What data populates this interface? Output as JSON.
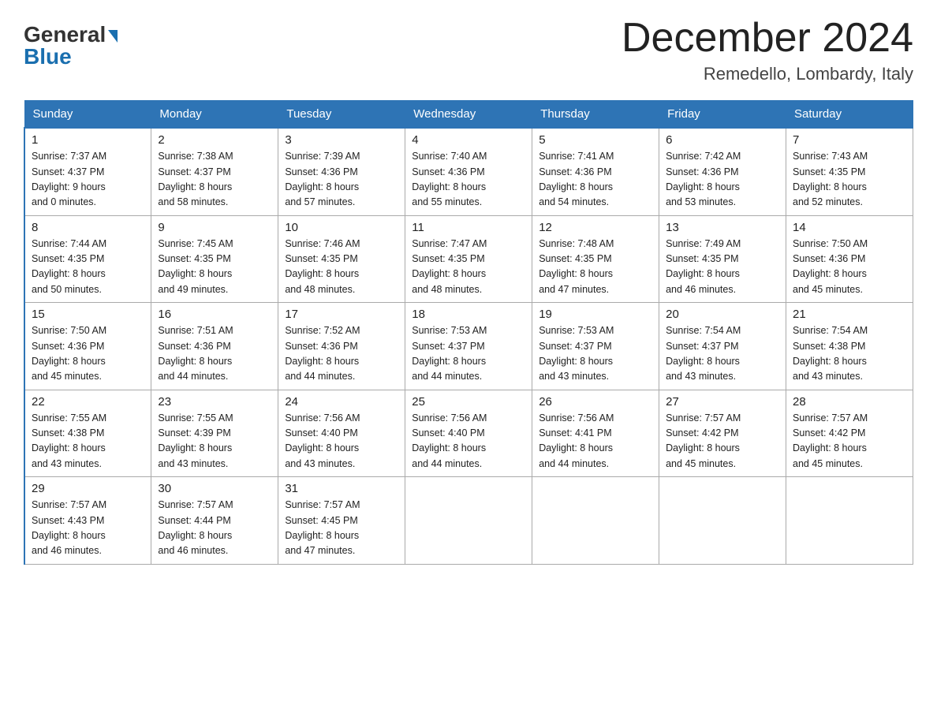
{
  "header": {
    "logo_general": "General",
    "logo_blue": "Blue",
    "month_title": "December 2024",
    "location": "Remedello, Lombardy, Italy"
  },
  "days_of_week": [
    "Sunday",
    "Monday",
    "Tuesday",
    "Wednesday",
    "Thursday",
    "Friday",
    "Saturday"
  ],
  "weeks": [
    [
      {
        "day": "1",
        "info": "Sunrise: 7:37 AM\nSunset: 4:37 PM\nDaylight: 9 hours\nand 0 minutes."
      },
      {
        "day": "2",
        "info": "Sunrise: 7:38 AM\nSunset: 4:37 PM\nDaylight: 8 hours\nand 58 minutes."
      },
      {
        "day": "3",
        "info": "Sunrise: 7:39 AM\nSunset: 4:36 PM\nDaylight: 8 hours\nand 57 minutes."
      },
      {
        "day": "4",
        "info": "Sunrise: 7:40 AM\nSunset: 4:36 PM\nDaylight: 8 hours\nand 55 minutes."
      },
      {
        "day": "5",
        "info": "Sunrise: 7:41 AM\nSunset: 4:36 PM\nDaylight: 8 hours\nand 54 minutes."
      },
      {
        "day": "6",
        "info": "Sunrise: 7:42 AM\nSunset: 4:36 PM\nDaylight: 8 hours\nand 53 minutes."
      },
      {
        "day": "7",
        "info": "Sunrise: 7:43 AM\nSunset: 4:35 PM\nDaylight: 8 hours\nand 52 minutes."
      }
    ],
    [
      {
        "day": "8",
        "info": "Sunrise: 7:44 AM\nSunset: 4:35 PM\nDaylight: 8 hours\nand 50 minutes."
      },
      {
        "day": "9",
        "info": "Sunrise: 7:45 AM\nSunset: 4:35 PM\nDaylight: 8 hours\nand 49 minutes."
      },
      {
        "day": "10",
        "info": "Sunrise: 7:46 AM\nSunset: 4:35 PM\nDaylight: 8 hours\nand 48 minutes."
      },
      {
        "day": "11",
        "info": "Sunrise: 7:47 AM\nSunset: 4:35 PM\nDaylight: 8 hours\nand 48 minutes."
      },
      {
        "day": "12",
        "info": "Sunrise: 7:48 AM\nSunset: 4:35 PM\nDaylight: 8 hours\nand 47 minutes."
      },
      {
        "day": "13",
        "info": "Sunrise: 7:49 AM\nSunset: 4:35 PM\nDaylight: 8 hours\nand 46 minutes."
      },
      {
        "day": "14",
        "info": "Sunrise: 7:50 AM\nSunset: 4:36 PM\nDaylight: 8 hours\nand 45 minutes."
      }
    ],
    [
      {
        "day": "15",
        "info": "Sunrise: 7:50 AM\nSunset: 4:36 PM\nDaylight: 8 hours\nand 45 minutes."
      },
      {
        "day": "16",
        "info": "Sunrise: 7:51 AM\nSunset: 4:36 PM\nDaylight: 8 hours\nand 44 minutes."
      },
      {
        "day": "17",
        "info": "Sunrise: 7:52 AM\nSunset: 4:36 PM\nDaylight: 8 hours\nand 44 minutes."
      },
      {
        "day": "18",
        "info": "Sunrise: 7:53 AM\nSunset: 4:37 PM\nDaylight: 8 hours\nand 44 minutes."
      },
      {
        "day": "19",
        "info": "Sunrise: 7:53 AM\nSunset: 4:37 PM\nDaylight: 8 hours\nand 43 minutes."
      },
      {
        "day": "20",
        "info": "Sunrise: 7:54 AM\nSunset: 4:37 PM\nDaylight: 8 hours\nand 43 minutes."
      },
      {
        "day": "21",
        "info": "Sunrise: 7:54 AM\nSunset: 4:38 PM\nDaylight: 8 hours\nand 43 minutes."
      }
    ],
    [
      {
        "day": "22",
        "info": "Sunrise: 7:55 AM\nSunset: 4:38 PM\nDaylight: 8 hours\nand 43 minutes."
      },
      {
        "day": "23",
        "info": "Sunrise: 7:55 AM\nSunset: 4:39 PM\nDaylight: 8 hours\nand 43 minutes."
      },
      {
        "day": "24",
        "info": "Sunrise: 7:56 AM\nSunset: 4:40 PM\nDaylight: 8 hours\nand 43 minutes."
      },
      {
        "day": "25",
        "info": "Sunrise: 7:56 AM\nSunset: 4:40 PM\nDaylight: 8 hours\nand 44 minutes."
      },
      {
        "day": "26",
        "info": "Sunrise: 7:56 AM\nSunset: 4:41 PM\nDaylight: 8 hours\nand 44 minutes."
      },
      {
        "day": "27",
        "info": "Sunrise: 7:57 AM\nSunset: 4:42 PM\nDaylight: 8 hours\nand 45 minutes."
      },
      {
        "day": "28",
        "info": "Sunrise: 7:57 AM\nSunset: 4:42 PM\nDaylight: 8 hours\nand 45 minutes."
      }
    ],
    [
      {
        "day": "29",
        "info": "Sunrise: 7:57 AM\nSunset: 4:43 PM\nDaylight: 8 hours\nand 46 minutes."
      },
      {
        "day": "30",
        "info": "Sunrise: 7:57 AM\nSunset: 4:44 PM\nDaylight: 8 hours\nand 46 minutes."
      },
      {
        "day": "31",
        "info": "Sunrise: 7:57 AM\nSunset: 4:45 PM\nDaylight: 8 hours\nand 47 minutes."
      },
      {
        "day": "",
        "info": ""
      },
      {
        "day": "",
        "info": ""
      },
      {
        "day": "",
        "info": ""
      },
      {
        "day": "",
        "info": ""
      }
    ]
  ]
}
